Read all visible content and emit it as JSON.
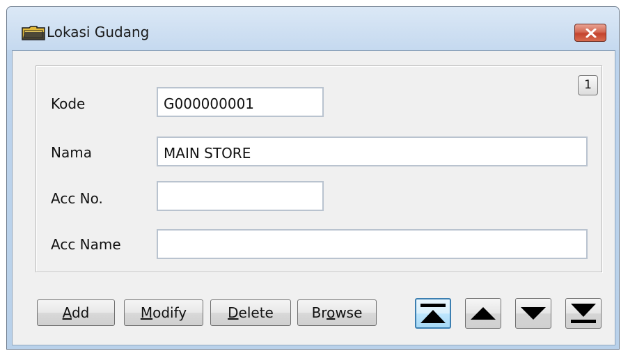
{
  "window": {
    "title": "Lokasi Gudang",
    "icon": "folder-icon",
    "close_icon": "close-icon"
  },
  "record": {
    "page_number": "1"
  },
  "form": {
    "kode": {
      "label": "Kode",
      "value": "G000000001"
    },
    "nama": {
      "label": "Nama",
      "value": "MAIN STORE"
    },
    "acc_no": {
      "label": "Acc No.",
      "value": ""
    },
    "acc_name": {
      "label": "Acc Name",
      "value": ""
    }
  },
  "buttons": {
    "add": {
      "pre": "",
      "mnemonic": "A",
      "post": "dd"
    },
    "modify": {
      "pre": "",
      "mnemonic": "M",
      "post": "odify"
    },
    "delete": {
      "pre": "",
      "mnemonic": "D",
      "post": "elete"
    },
    "browse": {
      "pre": "Br",
      "mnemonic": "o",
      "post": "wse"
    }
  },
  "navigation": {
    "first_icon": "first-record-icon",
    "prev_icon": "previous-record-icon",
    "next_icon": "next-record-icon",
    "last_icon": "last-record-icon"
  },
  "colors": {
    "close_button": "#c4442e",
    "focus_border": "#3c7fb1",
    "field_border": "#b9c3cf"
  }
}
